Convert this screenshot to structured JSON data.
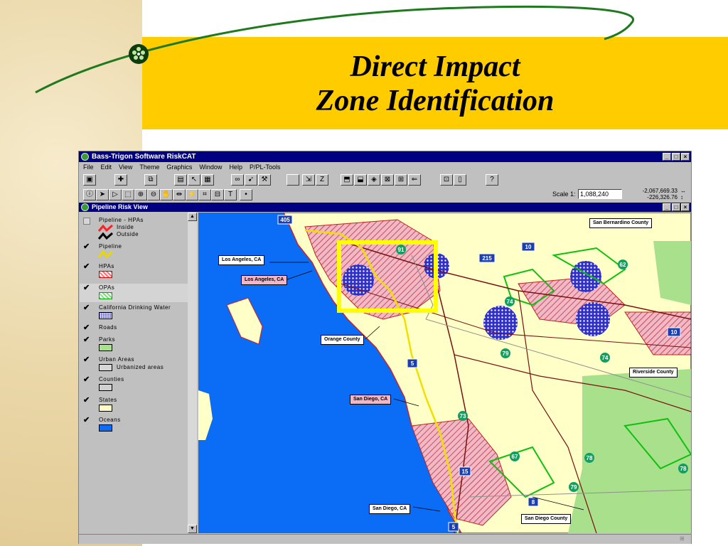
{
  "slide": {
    "title_line1": "Direct Impact",
    "title_line2": "Zone Identification",
    "colors": {
      "band": "#ffcc00",
      "accent_line": "#1f7a1f",
      "highlight_box": "#ffff00"
    }
  },
  "app": {
    "window_title": "Bass-Trigon Software RiskCAT",
    "menu": [
      "File",
      "Edit",
      "View",
      "Theme",
      "Graphics",
      "Window",
      "Help",
      "P/PL-Tools"
    ],
    "scale_label": "Scale 1:",
    "scale_value": "1,088,240",
    "coord_x": "-2,067,669.33",
    "coord_y": "-226,326.76",
    "child_title": "Pipeline Risk View"
  },
  "legend": {
    "items": [
      {
        "label": "Pipeline - HPAs",
        "checked": false,
        "sublabels": [
          "Inside",
          "Outside"
        ]
      },
      {
        "label": "Pipeline",
        "checked": true
      },
      {
        "label": "HPAs",
        "checked": true
      },
      {
        "label": "OPAs",
        "checked": true
      },
      {
        "label": "California Drinking Water",
        "checked": true
      },
      {
        "label": "Roads",
        "checked": true
      },
      {
        "label": "Parks",
        "checked": true
      },
      {
        "label": "Urban Areas",
        "checked": true,
        "sublabels": [
          "Urbanized areas"
        ]
      },
      {
        "label": "Counties",
        "checked": true
      },
      {
        "label": "States",
        "checked": true
      },
      {
        "label": "Oceans",
        "checked": true
      }
    ],
    "swatch_colors": {
      "hpas": "#ff6f6f",
      "opas": "#7fdc7f",
      "drinking_water": "#3a3ad0",
      "parks": "#a8e08c",
      "urban": "#d6d6d6",
      "counties": "#d0d0d0",
      "states": "#fffbc8",
      "oceans": "#0b6cf5"
    }
  },
  "map": {
    "labels": {
      "san_bernardino": "San Bernardino County",
      "los_angeles_white": "Los Angeles, CA",
      "los_angeles_pink": "Los Angeles, CA",
      "orange_county": "Orange County",
      "riverside": "Riverside County",
      "san_diego_pink": "San Diego, CA",
      "san_diego_white": "San Diego, CA",
      "san_diego_county": "San Diego County"
    },
    "highway_shields": [
      "405",
      "91",
      "10",
      "215",
      "62",
      "74",
      "79",
      "74",
      "5",
      "73",
      "67",
      "78",
      "79",
      "78",
      "15",
      "8",
      "5",
      "10"
    ]
  }
}
